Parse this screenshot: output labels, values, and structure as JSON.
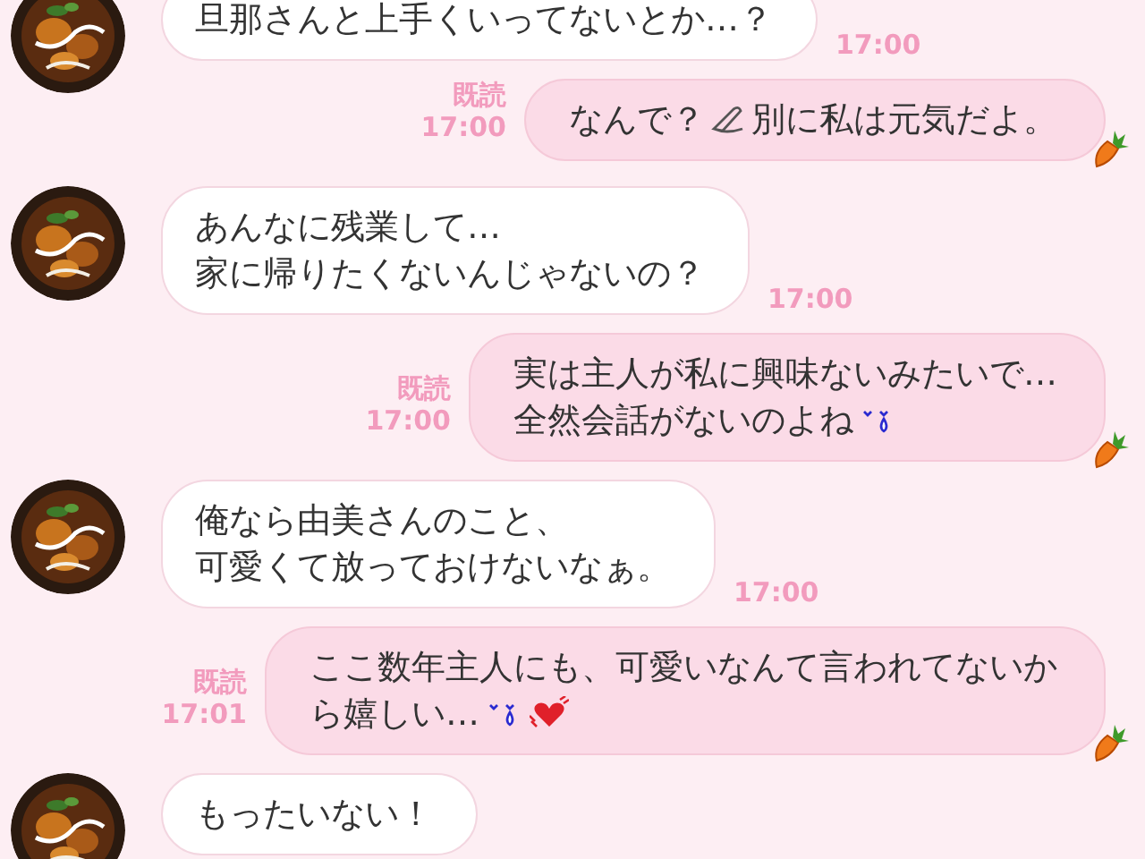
{
  "messages": [
    {
      "kind": "received",
      "lines": [
        [
          {
            "kind": "text",
            "text": "旦那さんと上手くいってないとか…？"
          }
        ]
      ],
      "time": "17:00"
    },
    {
      "kind": "sent",
      "read": "既読",
      "time": "17:00",
      "lines": [
        [
          {
            "kind": "text",
            "text": "なんで？"
          },
          {
            "kind": "pencil"
          },
          {
            "kind": "text",
            "text": "別に私は元気だよ。"
          }
        ]
      ]
    },
    {
      "kind": "received",
      "lines": [
        [
          {
            "kind": "text",
            "text": "あんなに残業して…"
          }
        ],
        [
          {
            "kind": "text",
            "text": "家に帰りたくないんじゃないの？"
          }
        ]
      ],
      "time": "17:00"
    },
    {
      "kind": "sent",
      "read": "既読",
      "time": "17:00",
      "lines": [
        [
          {
            "kind": "text",
            "text": "実は主人が私に興味ないみたいで…"
          }
        ],
        [
          {
            "kind": "text",
            "text": "全然会話がないのよね"
          },
          {
            "kind": "tear"
          }
        ]
      ]
    },
    {
      "kind": "received",
      "lines": [
        [
          {
            "kind": "text",
            "text": "俺なら由美さんのこと、"
          }
        ],
        [
          {
            "kind": "text",
            "text": "可愛くて放っておけないなぁ。"
          }
        ]
      ],
      "time": "17:00"
    },
    {
      "kind": "sent",
      "read": "既読",
      "time": "17:01",
      "lines": [
        [
          {
            "kind": "text",
            "text": "ここ数年主人にも、可愛いなんて言われてないか"
          }
        ],
        [
          {
            "kind": "text",
            "text": "ら嬉しい…"
          },
          {
            "kind": "tear"
          },
          {
            "kind": "heart"
          }
        ]
      ]
    },
    {
      "kind": "received",
      "lines": [
        [
          {
            "kind": "text",
            "text": "もったいない！"
          }
        ]
      ]
    }
  ]
}
